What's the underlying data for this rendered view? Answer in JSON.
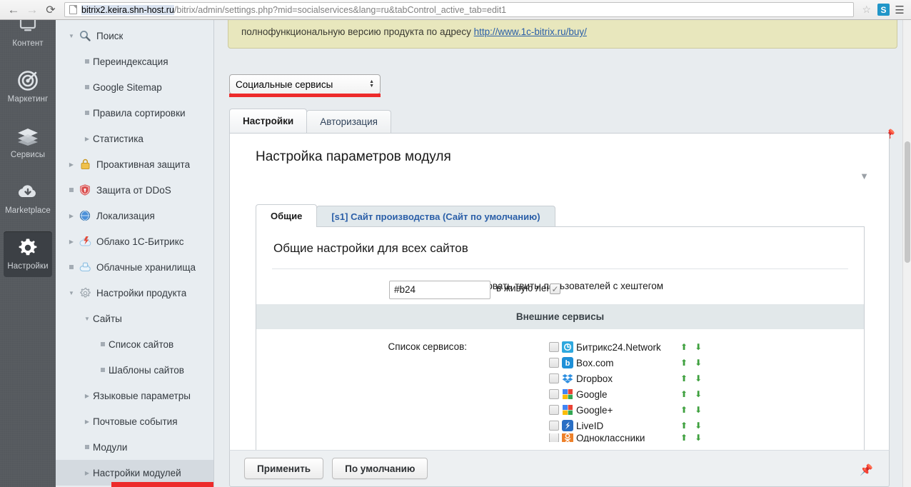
{
  "browser": {
    "back_icon": "back-arrow-icon",
    "forward_icon": "forward-arrow-icon",
    "reload_icon": "reload-icon",
    "url_host": "bitrix2.keira.shn-host.ru",
    "url_path": "/bitrix/admin/settings.php?mid=socialservices&lang=ru&tabControl_active_tab=edit1",
    "star_icon": "bookmark-star-icon",
    "extension_label": "S",
    "menu_icon": "hamburger-menu-icon"
  },
  "rail": {
    "items": [
      {
        "label": "Контент",
        "icon": "content-icon",
        "active": false
      },
      {
        "label": "Маркетинг",
        "icon": "marketing-target-icon",
        "active": false
      },
      {
        "label": "Сервисы",
        "icon": "services-layers-icon",
        "active": false
      },
      {
        "label": "Marketplace",
        "icon": "marketplace-cloud-download-icon",
        "active": false
      },
      {
        "label": "Настройки",
        "icon": "settings-gear-icon",
        "active": true
      }
    ]
  },
  "tree": {
    "items": [
      {
        "label": "Поиск",
        "level": 1,
        "toggle": "down",
        "icon": "search-magnifier-icon",
        "selected": false
      },
      {
        "label": "Переиндексация",
        "level": 2,
        "toggle": "bullet",
        "icon": "",
        "selected": false
      },
      {
        "label": "Google Sitemap",
        "level": 2,
        "toggle": "bullet",
        "icon": "",
        "selected": false
      },
      {
        "label": "Правила сортировки",
        "level": 2,
        "toggle": "bullet",
        "icon": "",
        "selected": false
      },
      {
        "label": "Статистика",
        "level": 2,
        "toggle": "right",
        "icon": "",
        "selected": false
      },
      {
        "label": "Проактивная защита",
        "level": 1,
        "toggle": "right",
        "icon": "lock-icon",
        "selected": false
      },
      {
        "label": "Защита от DDoS",
        "level": 1,
        "toggle": "bullet",
        "icon": "shield-icon",
        "selected": false
      },
      {
        "label": "Локализация",
        "level": 1,
        "toggle": "right",
        "icon": "globe-icon",
        "selected": false
      },
      {
        "label": "Облако 1С-Битрикс",
        "level": 1,
        "toggle": "right",
        "icon": "cloud-bitrix-icon",
        "selected": false
      },
      {
        "label": "Облачные хранилища",
        "level": 1,
        "toggle": "bullet",
        "icon": "cloud-storage-icon",
        "selected": false
      },
      {
        "label": "Настройки продукта",
        "level": 1,
        "toggle": "down",
        "icon": "product-gear-icon",
        "selected": false
      },
      {
        "label": "Сайты",
        "level": 2,
        "toggle": "down",
        "icon": "",
        "selected": false
      },
      {
        "label": "Список сайтов",
        "level": 3,
        "toggle": "bullet",
        "icon": "",
        "selected": false
      },
      {
        "label": "Шаблоны сайтов",
        "level": 3,
        "toggle": "bullet",
        "icon": "",
        "selected": false
      },
      {
        "label": "Языковые параметры",
        "level": 2,
        "toggle": "right",
        "icon": "",
        "selected": false
      },
      {
        "label": "Почтовые события",
        "level": 2,
        "toggle": "right",
        "icon": "",
        "selected": false
      },
      {
        "label": "Модули",
        "level": 2,
        "toggle": "bullet",
        "icon": "",
        "selected": false
      },
      {
        "label": "Настройки модулей",
        "level": 2,
        "toggle": "right",
        "icon": "",
        "selected": true
      }
    ]
  },
  "notice": {
    "text": "полнофункциональную версию продукта по адресу ",
    "link": "http://www.1c-bitrix.ru/buy/"
  },
  "module_select": {
    "value": "Социальные сервисы",
    "spinner_icon": "spinner-up-down-icon"
  },
  "outer_tabs": [
    {
      "label": "Настройки",
      "active": true
    },
    {
      "label": "Авторизация",
      "active": false
    }
  ],
  "pin_top_icon": "pin-icon",
  "pin_bottom_icon": "pin-icon",
  "panel": {
    "title": "Настройка параметров модуля",
    "collapse_icon": "triangle-down-collapse-icon"
  },
  "inner_tabs": [
    {
      "label": "Общие",
      "active": true
    },
    {
      "label": "[s1] Сайт производства (Сайт по умолчанию)",
      "active": false
    }
  ],
  "section": {
    "title": "Общие настройки для всех сайтов",
    "twitter_label_line1": "Транслировать твиты пользователей с хештегом",
    "hashtag_value": "#b24",
    "after_input_text": "в живую ленту",
    "live_feed_checkbox_checked": true,
    "external_services_header": "Внешние сервисы",
    "services_list_label": "Список сервисов:"
  },
  "services": [
    {
      "name": "Битрикс24.Network",
      "icon": "bitrix24-network-icon",
      "color": "#2ea8de",
      "glyph": "b",
      "checked": false
    },
    {
      "name": "Box.com",
      "icon": "box-icon",
      "color": "#1e90d8",
      "glyph": "b",
      "checked": false
    },
    {
      "name": "Dropbox",
      "icon": "dropbox-icon",
      "color": "#1b7ee0",
      "glyph": "❖",
      "checked": false
    },
    {
      "name": "Google",
      "icon": "google-icon",
      "color": "#dd4b39",
      "glyph": "G",
      "checked": false
    },
    {
      "name": "Google+",
      "icon": "google-plus-icon",
      "color": "#dd4b39",
      "glyph": "G",
      "checked": false
    },
    {
      "name": "LiveID",
      "icon": "liveid-icon",
      "color": "#2a6fc4",
      "glyph": "♪",
      "checked": false
    },
    {
      "name": "Одноклассники",
      "icon": "odnoklassniki-icon",
      "color": "#ed812b",
      "glyph": "o",
      "checked": false
    }
  ],
  "service_move_up_icon": "arrow-up-icon",
  "service_move_down_icon": "arrow-down-icon",
  "buttons": {
    "apply": "Применить",
    "defaults": "По умолчанию"
  },
  "colors": {
    "accent_red": "#ed2b2b",
    "link_blue": "#2b5fa8",
    "notice_bg": "#e8e7bd",
    "rail_bg": "#55595e",
    "tree_bg": "#e8edf1",
    "green_arrow": "#3ea03e"
  }
}
